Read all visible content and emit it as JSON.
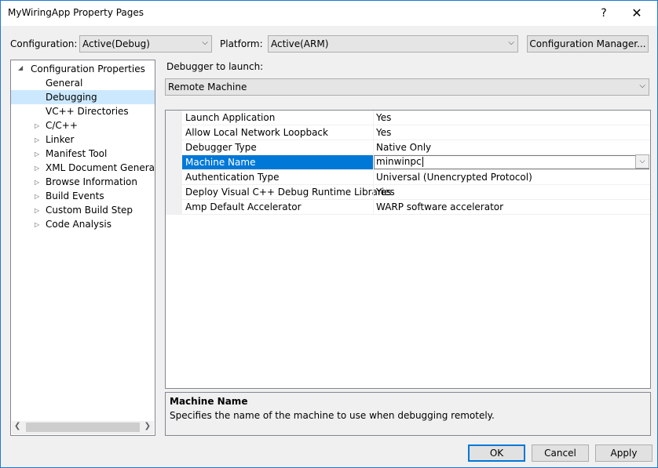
{
  "window": {
    "title": "MyWiringApp Property Pages",
    "help_glyph": "?",
    "close_glyph": "✕"
  },
  "config_bar": {
    "configuration_label": "Configuration:",
    "configuration_value": "Active(Debug)",
    "platform_label": "Platform:",
    "platform_value": "Active(ARM)",
    "config_manager_label": "Configuration Manager..."
  },
  "tree": {
    "root_label": "Configuration Properties",
    "items": [
      {
        "label": "General",
        "expandable": false
      },
      {
        "label": "Debugging",
        "expandable": false,
        "selected": true
      },
      {
        "label": "VC++ Directories",
        "expandable": false
      },
      {
        "label": "C/C++",
        "expandable": true
      },
      {
        "label": "Linker",
        "expandable": true
      },
      {
        "label": "Manifest Tool",
        "expandable": true
      },
      {
        "label": "XML Document Generator",
        "expandable": true
      },
      {
        "label": "Browse Information",
        "expandable": true
      },
      {
        "label": "Build Events",
        "expandable": true
      },
      {
        "label": "Custom Build Step",
        "expandable": true
      },
      {
        "label": "Code Analysis",
        "expandable": true
      }
    ]
  },
  "debugger": {
    "label": "Debugger to launch:",
    "value": "Remote Machine"
  },
  "properties": [
    {
      "name": "Launch Application",
      "value": "Yes"
    },
    {
      "name": "Allow Local Network Loopback",
      "value": "Yes"
    },
    {
      "name": "Debugger Type",
      "value": "Native Only"
    },
    {
      "name": "Machine Name",
      "value": "minwinpc",
      "selected": true
    },
    {
      "name": "Authentication Type",
      "value": "Universal (Unencrypted Protocol)"
    },
    {
      "name": "Deploy Visual C++ Debug Runtime Libraries",
      "value": "Yes"
    },
    {
      "name": "Amp Default Accelerator",
      "value": "WARP software accelerator"
    }
  ],
  "description": {
    "title": "Machine Name",
    "text": "Specifies the name of the machine to use when debugging remotely."
  },
  "buttons": {
    "ok": "OK",
    "cancel": "Cancel",
    "apply": "Apply"
  },
  "colors": {
    "accent": "#0078d7",
    "selection_tree": "#cce8ff",
    "window_border": "#1e78d7"
  }
}
